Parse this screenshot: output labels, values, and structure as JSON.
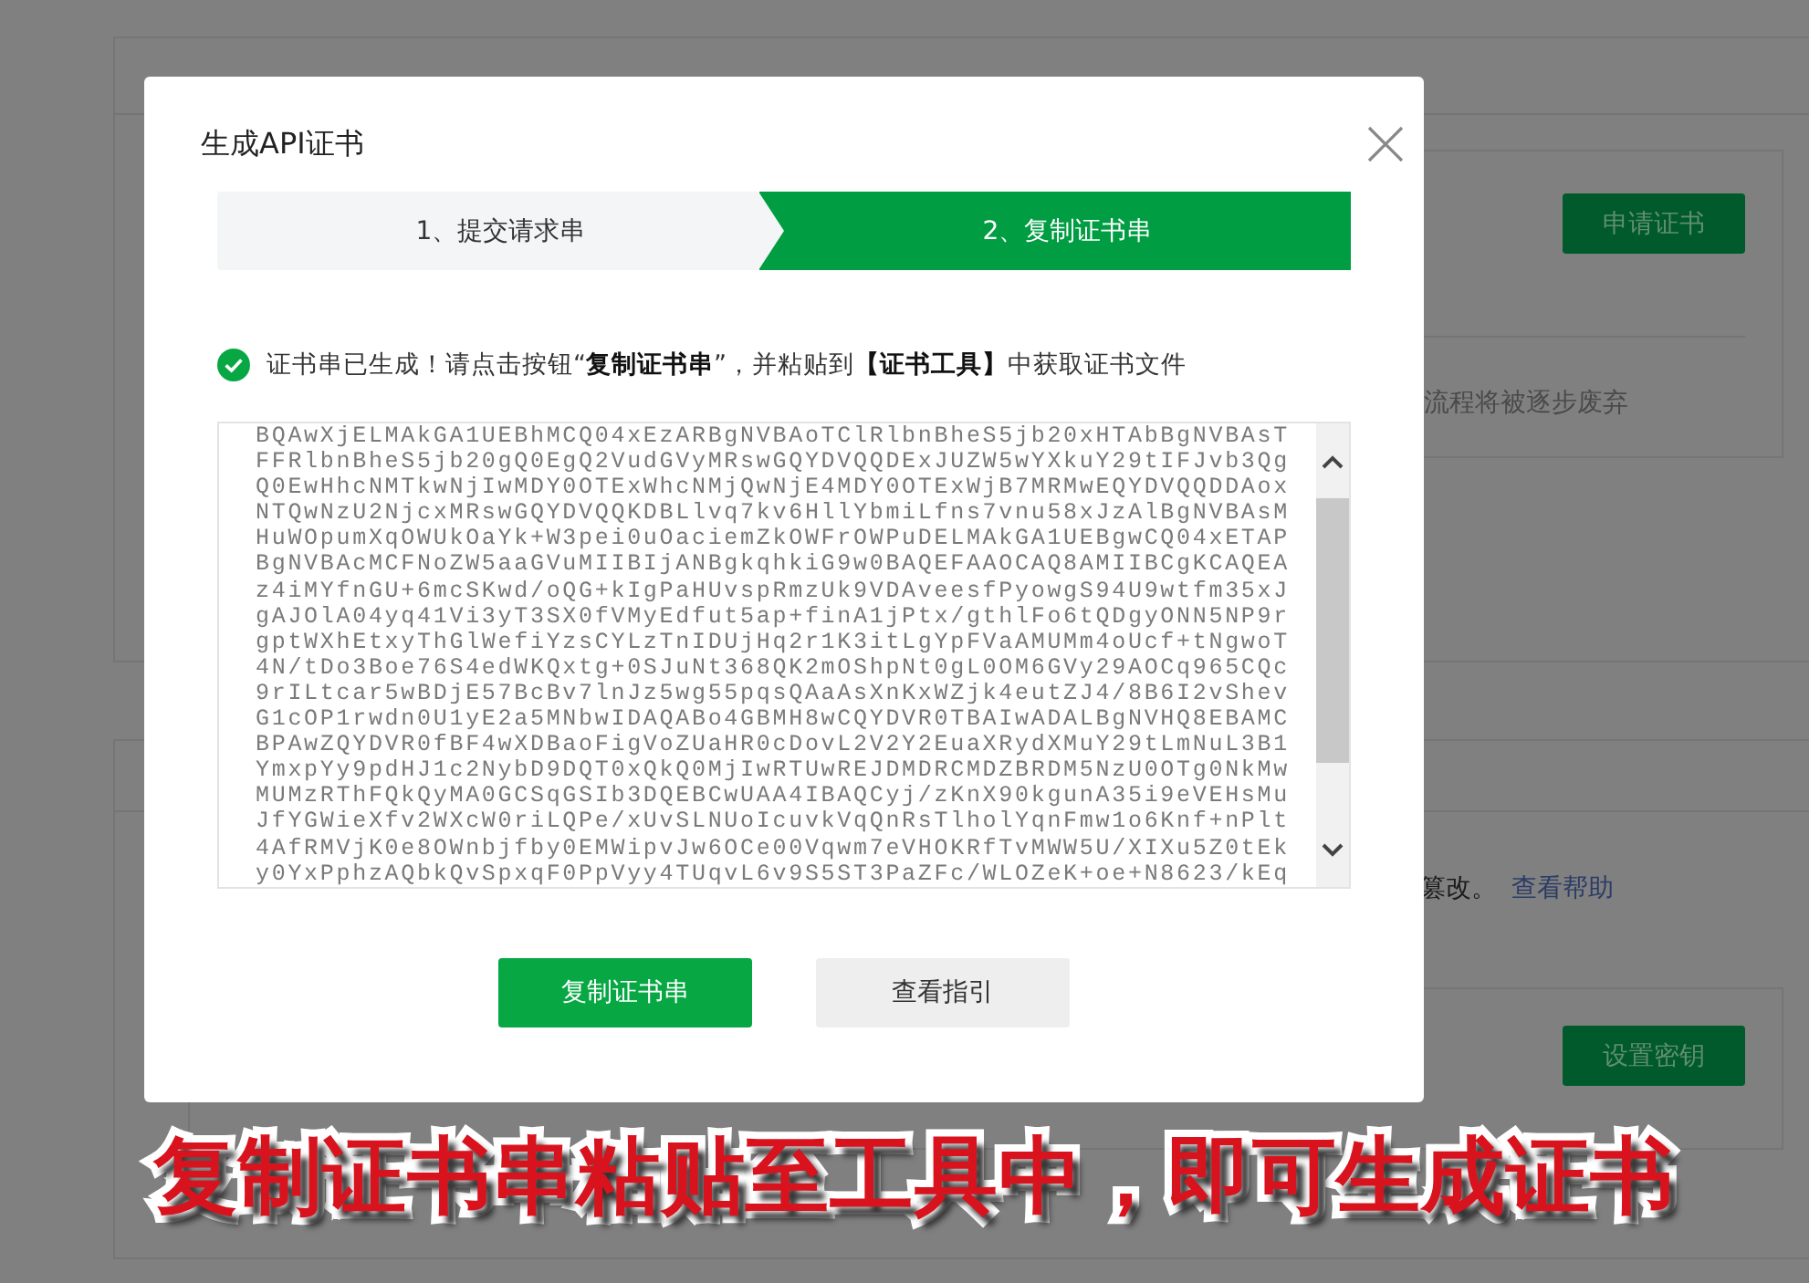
{
  "background_page": {
    "apply_button": "申请证书",
    "deprecation_note": "流程将被逐步废弃",
    "tamper_note": "篡改。",
    "help_link": "查看帮助",
    "set_key_button": "设置密钥"
  },
  "dialog": {
    "title": "生成API证书",
    "steps": [
      {
        "label": "1、提交请求串",
        "selected": false
      },
      {
        "label": "2、复制证书串",
        "selected": true
      }
    ],
    "notice": "证书串已生成！请点击按钮“**复制证书串**”，并粘贴到**【证书工具】**中获取证书文件",
    "certificate_lines": [
      "BQAwXjELMAkGA1UEBhMCQ04xEzARBgNVBAoTClRlbnBheS5jb20xHTAbBgNVBAsT",
      "FFRlbnBheS5jb20gQ0EgQ2VudGVyMRswGQYDVQQDExJUZW5wYXkuY29tIFJvb3Qg",
      "Q0EwHhcNMTkwNjIwMDY0OTExWhcNMjQwNjE4MDY0OTExWjB7MRMwEQYDVQQDDAox",
      "NTQwNzU2NjcxMRswGQYDVQQKDBLlvq7kv6HllYbmiLfns7vnu58xJzAlBgNVBAsM",
      "HuWOpumXqOWUkOaYk+W3pei0uOaciemZkOWFrOWPuDELMAkGA1UEBgwCQ04xETAP",
      "BgNVBAcMCFNoZW5aaGVuMIIBIjANBgkqhkiG9w0BAQEFAAOCAQ8AMIIBCgKCAQEA",
      "z4iMYfnGU+6mcSKwd/oQG+kIgPaHUvspRmzUk9VDAveesfPyowgS94U9wtfm35xJ",
      "gAJOlA04yq41Vi3yT3SX0fVMyEdfut5ap+finA1jPtx/gthlFo6tQDgyONN5NP9r",
      "gptWXhEtxyThGlWefiYzsCYLzTnIDUjHq2r1K3itLgYpFVaAMUMm4oUcf+tNgwoT",
      "4N/tDo3Boe76S4edWKQxtg+0SJuNt368QK2mOShpNt0gL0OM6GVy29AOCq965CQc",
      "9rILtcar5wBDjE57BcBv7lnJz5wg55pqsQAaAsXnKxWZjk4eutZJ4/8B6I2vShev",
      "G1cOP1rwdn0U1yE2a5MNbwIDAQABo4GBMH8wCQYDVR0TBAIwADALBgNVHQ8EBAMC",
      "BPAwZQYDVR0fBF4wXDBaoFigVoZUaHR0cDovL2V2Y2EuaXRydXMuY29tLmNuL3B1",
      "YmxpYy9pdHJ1c2NybD9DQT0xQkQ0MjIwRTUwREJDMDRCMDZBRDM5NzU0OTg0NkMw",
      "MUMzRThFQkQyMA0GCSqGSIb3DQEBCwUAA4IBAQCyj/zKnX90kgunA35i9eVEHsMu",
      "JfYGWieXfv2WXcW0riLQPe/xUvSLNUoIcuvkVqQnRsTlholYqnFmw1o6Knf+nPlt",
      "4AfRMVjK0e8OWnbjfby0EMWipvJw6OCe00Vqwm7eVHOKRfTvMWW5U/XIXu5Z0tEk",
      "y0YxPphzAQbkQvSpxqF0PpVyy4TUqvL6v9S5ST3PaZFc/WLOZeK+oe+N8623/kEq"
    ],
    "buttons": [
      {
        "label": "复制证书串",
        "kind": "primary"
      },
      {
        "label": "查看指引",
        "kind": "secondary"
      }
    ]
  },
  "caption": "复制证书串粘贴至工具中，即可生成证书"
}
